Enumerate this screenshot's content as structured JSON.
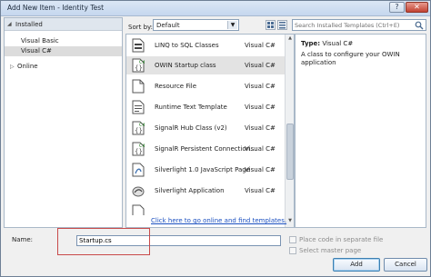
{
  "window": {
    "title": "Add New Item - Identity Test",
    "help_glyph": "?",
    "close_glyph": "✕"
  },
  "left_panel": {
    "installed_label": "Installed",
    "tree": [
      "Visual Basic",
      "Visual C#"
    ],
    "online_label": "Online"
  },
  "toolbar": {
    "sort_label": "Sort by:",
    "sort_value": "Default",
    "search_placeholder": "Search Installed Templates (Ctrl+E)"
  },
  "templates": [
    {
      "name": "LINQ to SQL Classes",
      "lang": "Visual C#",
      "icon": "linq-icon"
    },
    {
      "name": "OWIN Startup class",
      "lang": "Visual C#",
      "icon": "csharp-file-icon",
      "selected": true
    },
    {
      "name": "Resource File",
      "lang": "Visual C#",
      "icon": "resource-file-icon"
    },
    {
      "name": "Runtime Text Template",
      "lang": "Visual C#",
      "icon": "text-template-icon"
    },
    {
      "name": "SignalR Hub Class (v2)",
      "lang": "Visual C#",
      "icon": "csharp-file-icon"
    },
    {
      "name": "SignalR Persistent Connection...",
      "lang": "Visual C#",
      "icon": "csharp-file-icon"
    },
    {
      "name": "Silverlight 1.0 JavaScript Page",
      "lang": "Visual C#",
      "icon": "javascript-page-icon"
    },
    {
      "name": "Silverlight Application",
      "lang": "Visual C#",
      "icon": "silverlight-icon"
    }
  ],
  "online_link": "Click here to go online and find templates.",
  "details": {
    "type_label": "Type:",
    "type_value": "Visual C#",
    "description": "A class to configure your OWIN application"
  },
  "bottom": {
    "name_label": "Name:",
    "name_value": "Startup.cs",
    "place_code_label": "Place code in separate file",
    "select_master_label": "Select master page",
    "add_label": "Add",
    "cancel_label": "Cancel"
  },
  "colors": {
    "highlight": "#c84a4a",
    "link": "#1a4fc0",
    "csharp_badge": "#1f7a1f"
  }
}
